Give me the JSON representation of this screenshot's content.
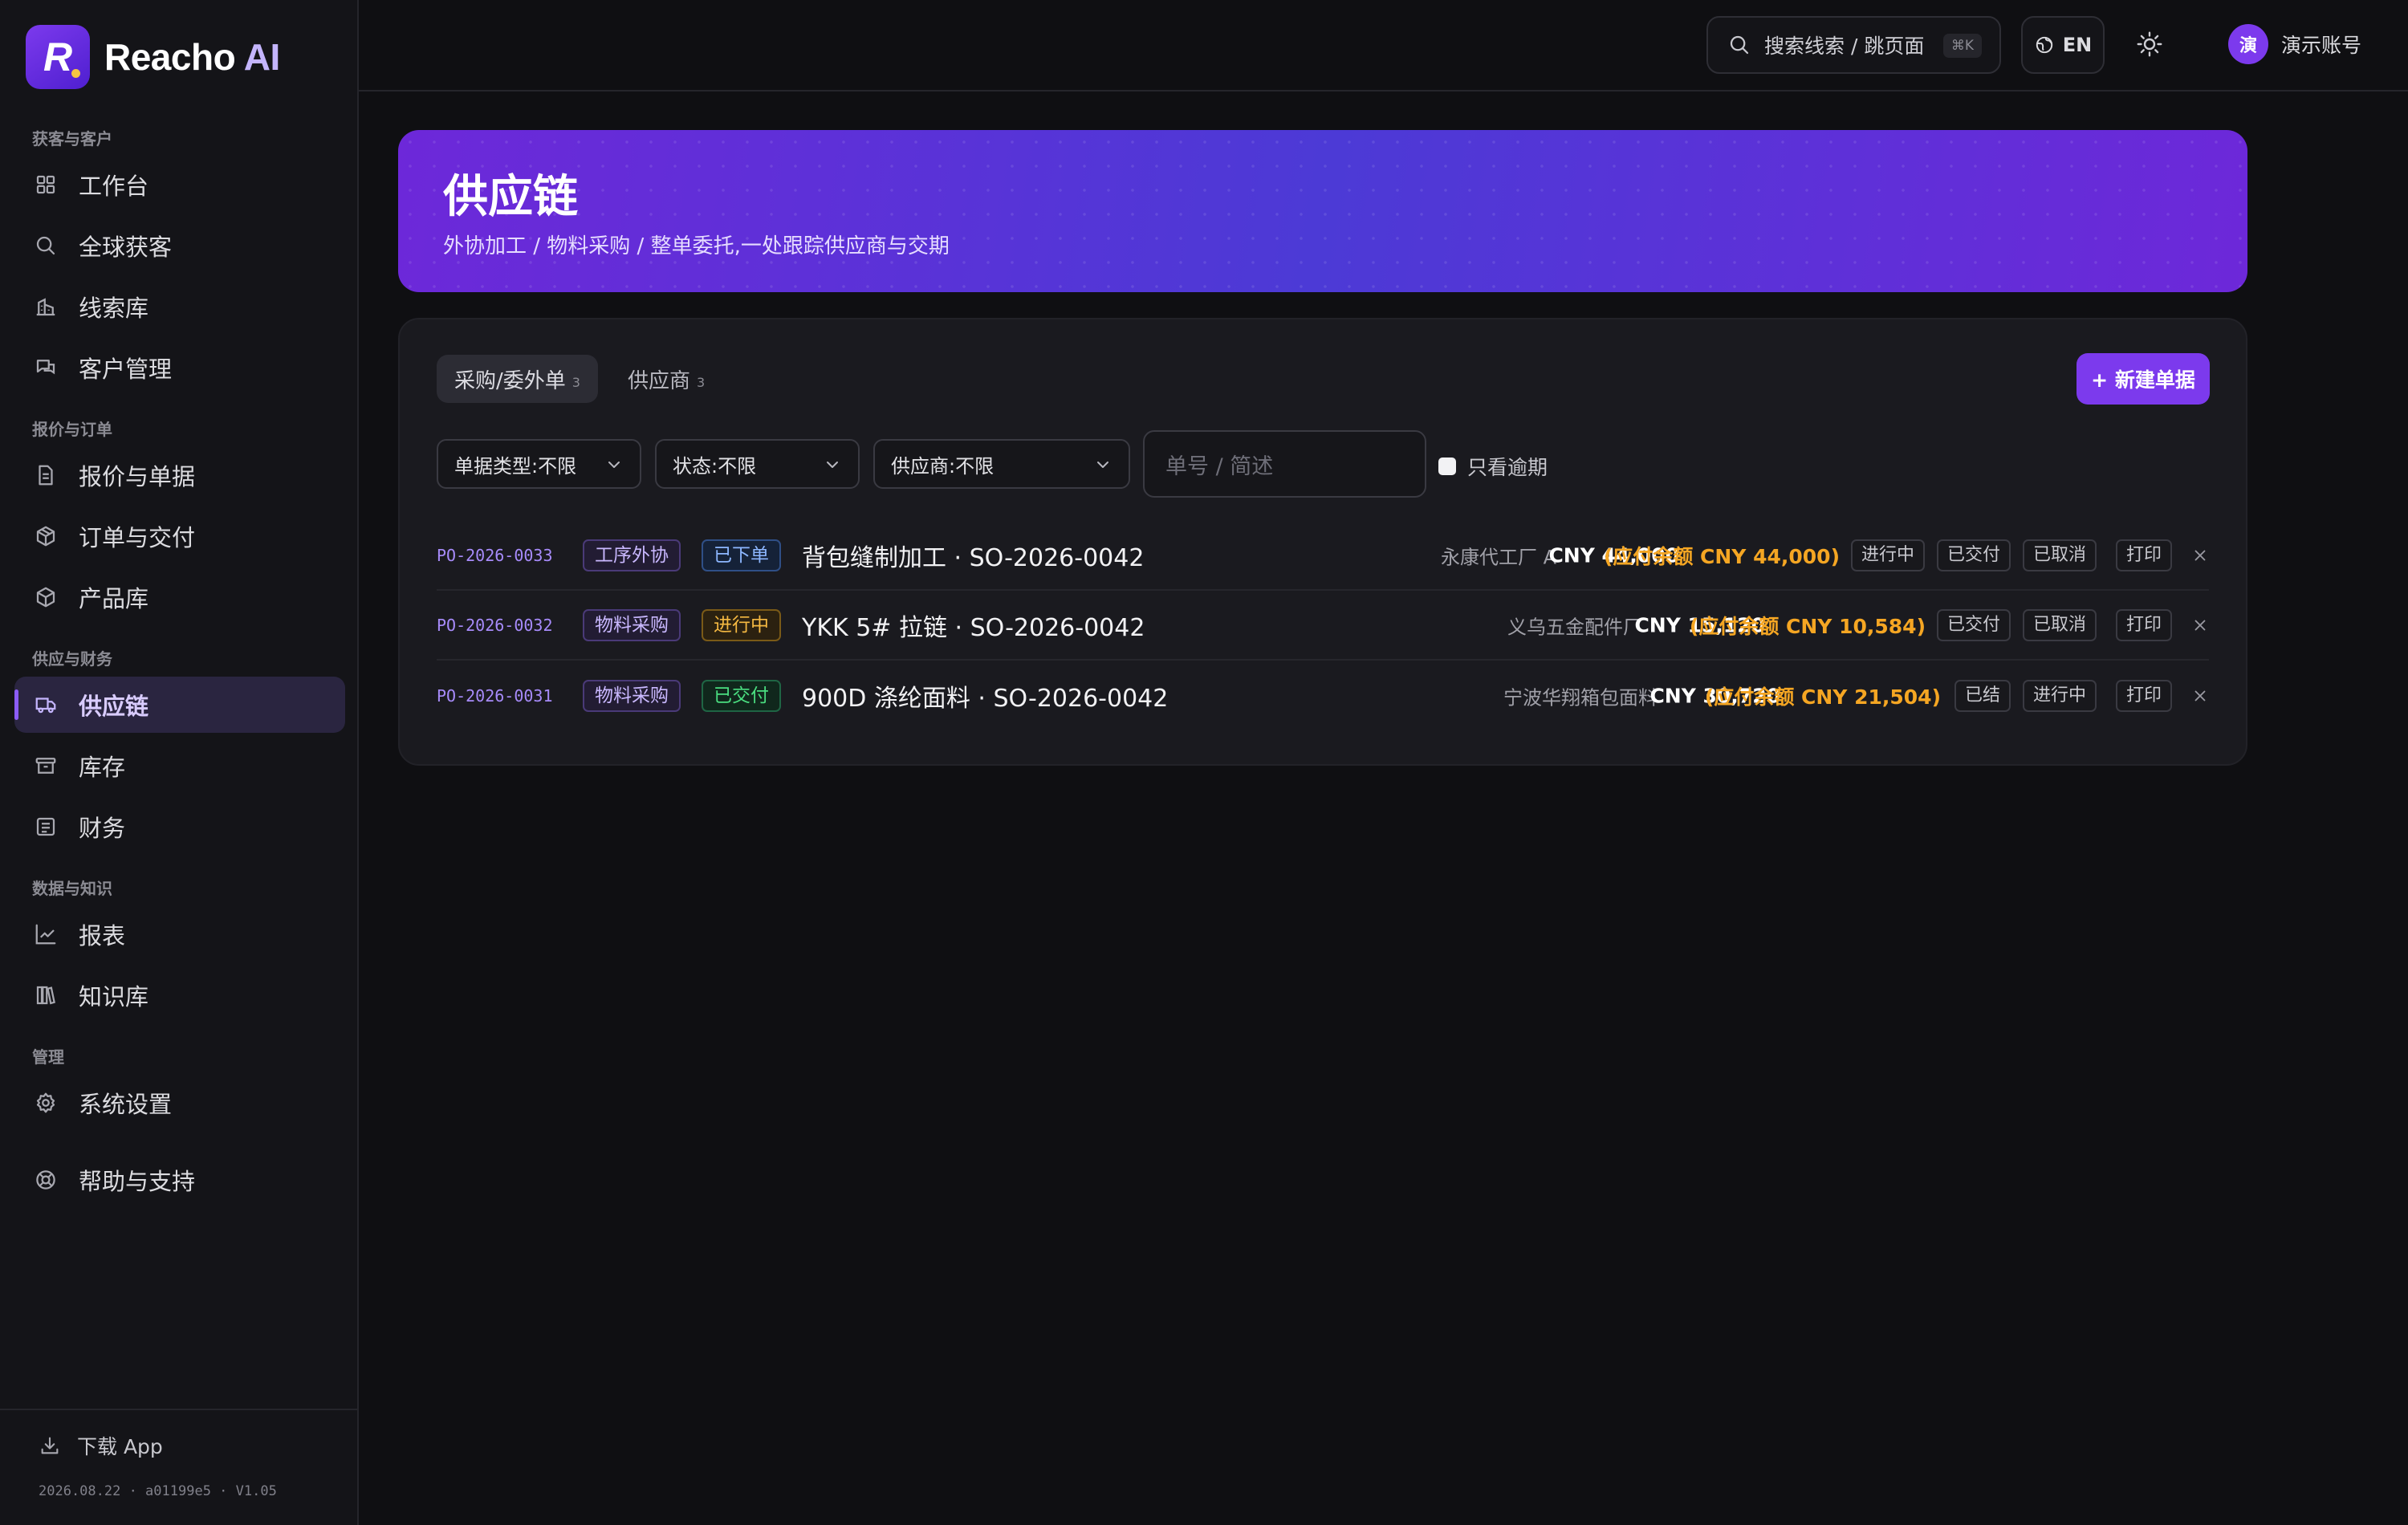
{
  "brand": {
    "logo_letter": "R",
    "name": "Reacho",
    "name_accent": "AI"
  },
  "sidebar": {
    "groups": [
      {
        "title": "获客与客户",
        "items": [
          {
            "label": "工作台",
            "icon": "dashboard-icon"
          },
          {
            "label": "全球获客",
            "icon": "search-icon"
          },
          {
            "label": "线索库",
            "icon": "building-icon"
          },
          {
            "label": "客户管理",
            "icon": "chat-icon"
          }
        ]
      },
      {
        "title": "报价与订单",
        "items": [
          {
            "label": "报价与单据",
            "icon": "document-icon"
          },
          {
            "label": "订单与交付",
            "icon": "package-icon"
          },
          {
            "label": "产品库",
            "icon": "box-icon"
          }
        ]
      },
      {
        "title": "供应与财务",
        "items": [
          {
            "label": "供应链",
            "icon": "truck-icon",
            "active": true
          },
          {
            "label": "库存",
            "icon": "archive-icon"
          },
          {
            "label": "财务",
            "icon": "receipt-icon"
          }
        ]
      },
      {
        "title": "数据与知识",
        "items": [
          {
            "label": "报表",
            "icon": "chart-icon"
          },
          {
            "label": "知识库",
            "icon": "books-icon"
          }
        ]
      },
      {
        "title": "管理",
        "items": [
          {
            "label": "系统设置",
            "icon": "gear-icon"
          },
          {
            "label": "帮助与支持",
            "icon": "lifebuoy-icon"
          }
        ]
      }
    ],
    "download_label": "下载 App",
    "version": "2026.08.22 · a01199e5 · V1.05"
  },
  "topbar": {
    "search_label": "搜索线索 / 跳页面",
    "search_kbd": "⌘K",
    "lang": "EN",
    "avatar_initial": "演",
    "account_name": "演示账号"
  },
  "banner": {
    "title": "供应链",
    "subtitle": "外协加工 / 物料采购 / 整单委托,一处跟踪供应商与交期"
  },
  "tabs": [
    {
      "label": "采购/委外单",
      "count": "3",
      "active": true
    },
    {
      "label": "供应商",
      "count": "3",
      "active": false
    }
  ],
  "new_button": "+ 新建单据",
  "filters": {
    "doc_type": "单据类型:不限",
    "status": "状态:不限",
    "supplier": "供应商:不限",
    "search_placeholder": "单号 / 简述",
    "overdue_label": "只看逾期"
  },
  "orders": [
    {
      "code": "PO-2026-0033",
      "type": "工序外协",
      "status": "已下单",
      "status_kind": "ordered",
      "title": "背包缝制加工 · SO-2026-0042",
      "supplier": "永康代工厂 A",
      "amount": "CNY 44,000",
      "balance": "(应付余额 CNY 44,000)",
      "actions": [
        "进行中",
        "已交付",
        "已取消",
        "打印"
      ]
    },
    {
      "code": "PO-2026-0032",
      "type": "物料采购",
      "status": "进行中",
      "status_kind": "progress",
      "title": "YKK 5# 拉链 · SO-2026-0042",
      "supplier": "义乌五金配件厂",
      "amount": "CNY 15,120",
      "balance": "(应付余额 CNY 10,584)",
      "actions": [
        "已交付",
        "已取消",
        "打印"
      ]
    },
    {
      "code": "PO-2026-0031",
      "type": "物料采购",
      "status": "已交付",
      "status_kind": "delivered",
      "title": "900D 涤纶面料 · SO-2026-0042",
      "supplier": "宁波华翔箱包面料",
      "amount": "CNY 30,720",
      "balance": "(应付余额 CNY 21,504)",
      "actions": [
        "已结",
        "进行中",
        "打印"
      ]
    }
  ]
}
